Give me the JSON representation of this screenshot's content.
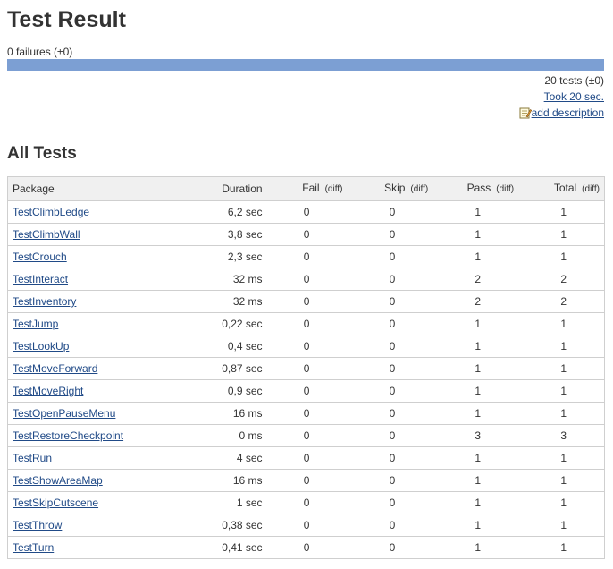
{
  "header": {
    "title": "Test Result",
    "failures": "0 failures (±0)"
  },
  "status_bar": {
    "color": "#7c9fd3",
    "pass_fraction": 1.0
  },
  "summary": {
    "tests": "20 tests (±0)",
    "took": "Took 20 sec.",
    "add_description": "add description",
    "add_description_icon": "notepad-pencil-icon"
  },
  "all_tests": {
    "title": "All Tests",
    "columns": {
      "package": "Package",
      "duration": "Duration",
      "fail": "Fail",
      "skip": "Skip",
      "pass": "Pass",
      "total": "Total",
      "diff": "(diff)"
    },
    "rows": [
      {
        "package": "TestClimbLedge",
        "duration": "6,2 sec",
        "fail": "0",
        "skip": "0",
        "pass": "1",
        "total": "1"
      },
      {
        "package": "TestClimbWall",
        "duration": "3,8 sec",
        "fail": "0",
        "skip": "0",
        "pass": "1",
        "total": "1"
      },
      {
        "package": "TestCrouch",
        "duration": "2,3 sec",
        "fail": "0",
        "skip": "0",
        "pass": "1",
        "total": "1"
      },
      {
        "package": "TestInteract",
        "duration": "32 ms",
        "fail": "0",
        "skip": "0",
        "pass": "2",
        "total": "2"
      },
      {
        "package": "TestInventory",
        "duration": "32 ms",
        "fail": "0",
        "skip": "0",
        "pass": "2",
        "total": "2"
      },
      {
        "package": "TestJump",
        "duration": "0,22 sec",
        "fail": "0",
        "skip": "0",
        "pass": "1",
        "total": "1"
      },
      {
        "package": "TestLookUp",
        "duration": "0,4 sec",
        "fail": "0",
        "skip": "0",
        "pass": "1",
        "total": "1"
      },
      {
        "package": "TestMoveForward",
        "duration": "0,87 sec",
        "fail": "0",
        "skip": "0",
        "pass": "1",
        "total": "1"
      },
      {
        "package": "TestMoveRight",
        "duration": "0,9 sec",
        "fail": "0",
        "skip": "0",
        "pass": "1",
        "total": "1"
      },
      {
        "package": "TestOpenPauseMenu",
        "duration": "16 ms",
        "fail": "0",
        "skip": "0",
        "pass": "1",
        "total": "1"
      },
      {
        "package": "TestRestoreCheckpoint",
        "duration": "0 ms",
        "fail": "0",
        "skip": "0",
        "pass": "3",
        "total": "3"
      },
      {
        "package": "TestRun",
        "duration": "4 sec",
        "fail": "0",
        "skip": "0",
        "pass": "1",
        "total": "1"
      },
      {
        "package": "TestShowAreaMap",
        "duration": "16 ms",
        "fail": "0",
        "skip": "0",
        "pass": "1",
        "total": "1"
      },
      {
        "package": "TestSkipCutscene",
        "duration": "1 sec",
        "fail": "0",
        "skip": "0",
        "pass": "1",
        "total": "1"
      },
      {
        "package": "TestThrow",
        "duration": "0,38 sec",
        "fail": "0",
        "skip": "0",
        "pass": "1",
        "total": "1"
      },
      {
        "package": "TestTurn",
        "duration": "0,41 sec",
        "fail": "0",
        "skip": "0",
        "pass": "1",
        "total": "1"
      }
    ]
  }
}
